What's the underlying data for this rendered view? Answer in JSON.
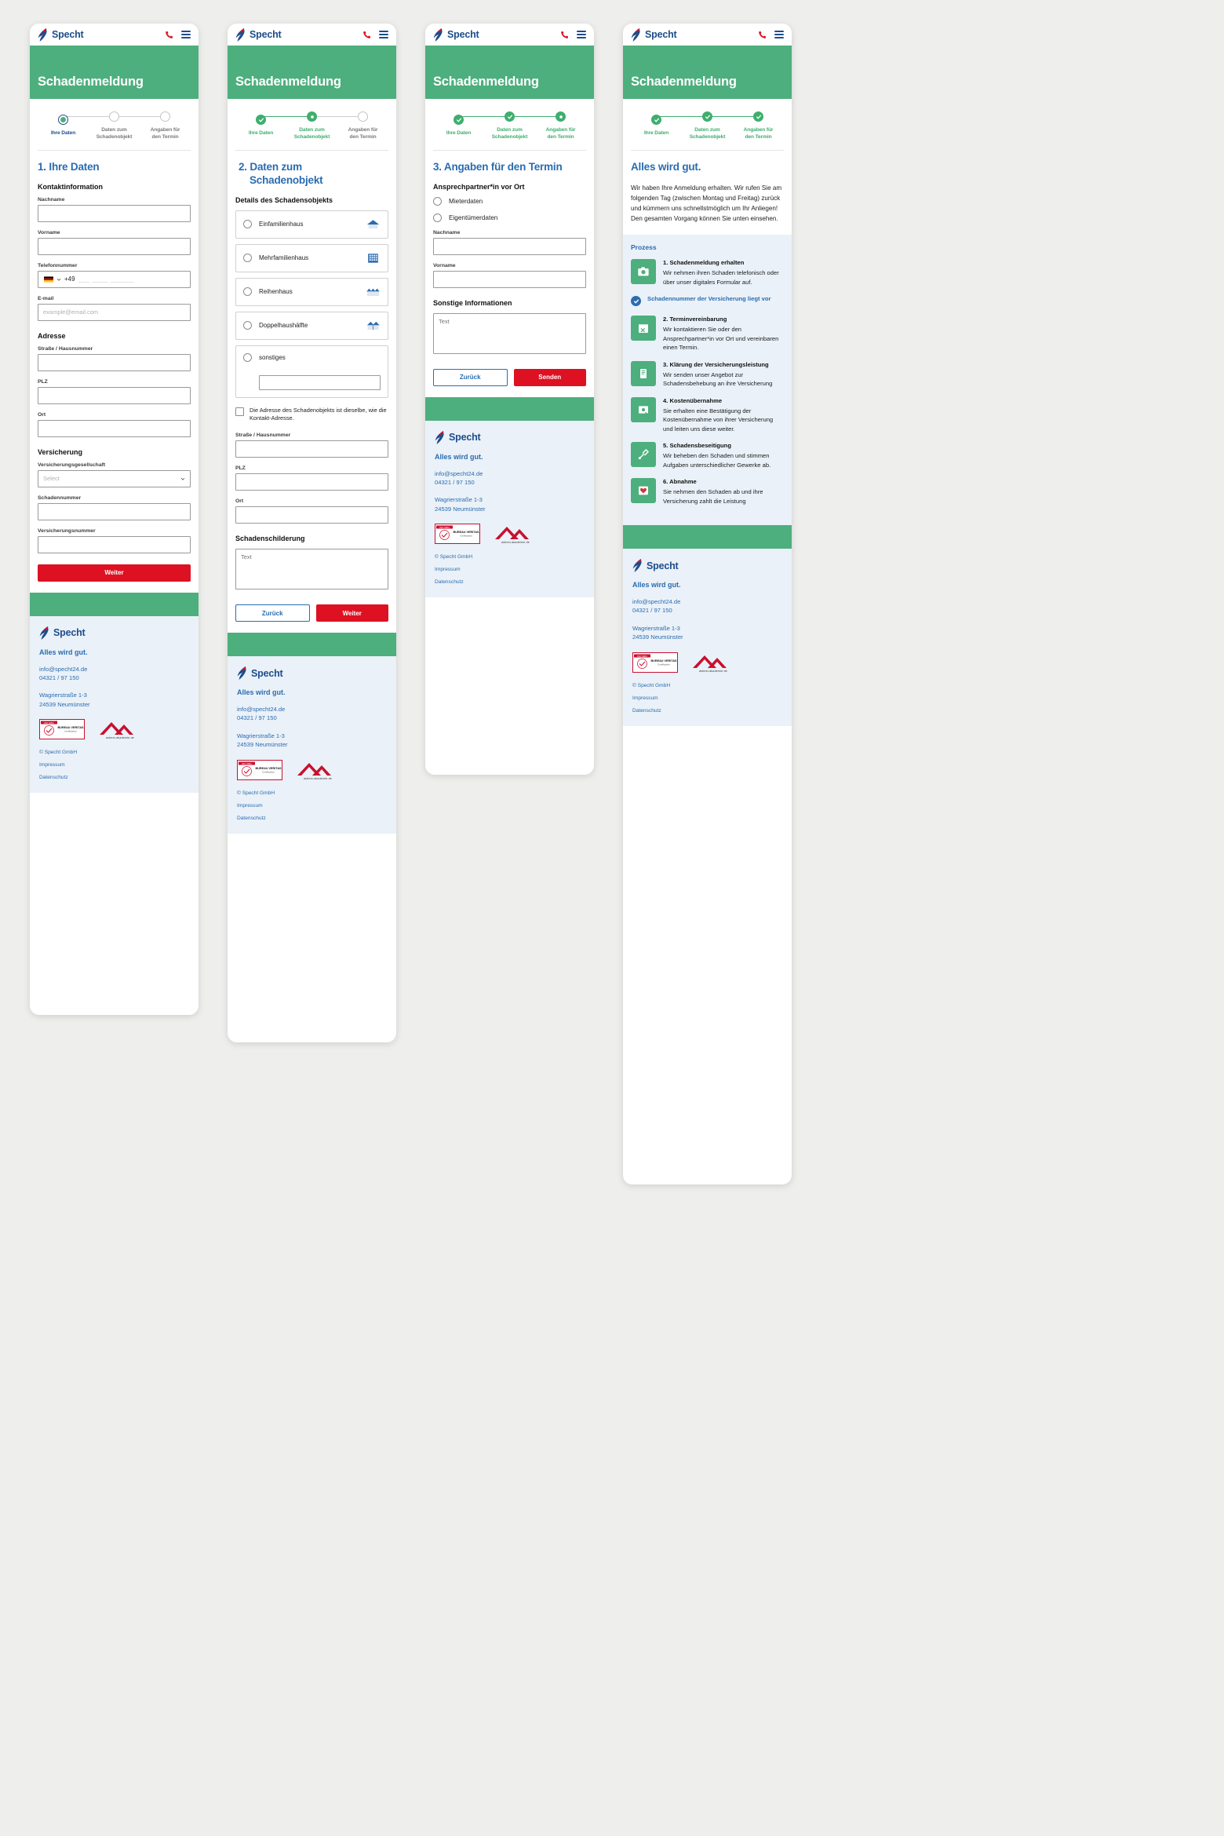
{
  "brand": {
    "name": "Specht",
    "slogan": "Alles wird gut.",
    "logo_icon": "specht-bird-logo",
    "phone_icon": "phone-icon",
    "menu_icon": "hamburger-menu-icon"
  },
  "hero": {
    "title": "Schadenmeldung"
  },
  "stepper": {
    "step1": "Ihre Daten",
    "step2_line1": "Daten zum",
    "step2_line2": "Schadenobjekt",
    "step3_line1": "Angaben für",
    "step3_line2": "den Termin"
  },
  "step1": {
    "title": "1. Ihre Daten",
    "group_contact": "Kontaktinformation",
    "nachname": "Nachname",
    "vorname": "Vorname",
    "telefonnummer": "Telefonnummer",
    "country_code": "+49",
    "phone_mask": "___  ____  ______",
    "email_label": "E-mail",
    "email_placeholder": "example@email.com",
    "group_address": "Adresse",
    "strasse": "Straße / Hausnummer",
    "plz": "PLZ",
    "ort": "Ort",
    "group_insurance": "Versicherung",
    "gesellschaft": "Versicherungsgesellschaft",
    "gesellschaft_placeholder": "Select",
    "schadennummer": "Schadennummer",
    "versicherungsnummer": "Versicherungsnummer",
    "weiter": "Weiter"
  },
  "step2": {
    "title_line1": "2. Daten zum",
    "title_line2": "Schadenobjekt",
    "group_details": "Details des Schadensobjekts",
    "options": [
      {
        "label": "Einfamilienhaus",
        "icon": "single-family-house-icon"
      },
      {
        "label": "Mehrfamilienhaus",
        "icon": "apartment-building-icon"
      },
      {
        "label": "Reihenhaus",
        "icon": "terraced-house-icon"
      },
      {
        "label": "Doppelhaushälfte",
        "icon": "semi-detached-house-icon"
      },
      {
        "label": "sonstiges",
        "icon": "none"
      }
    ],
    "sonstiges_value": "",
    "checkbox_label": "Die Adresse des Schadenobjekts ist dieselbe, wie die Kontakt-Adresse.",
    "strasse": "Straße / Hausnummer",
    "plz": "PLZ",
    "ort": "Ort",
    "schadenschilderung": "Schadenschilderung",
    "textarea_placeholder": "Text",
    "zurueck": "Zurück",
    "weiter": "Weiter"
  },
  "step3": {
    "title": "3. Angaben für den Termin",
    "group_contact_onsite": "Ansprechpartner*in vor Ort",
    "radio_mieter": "Mieterdaten",
    "radio_eigentuemer": "Eigentümerdaten",
    "nachname": "Nachname",
    "vorname": "Vorname",
    "group_other": "Sonstige Informationen",
    "textarea_placeholder": "Text",
    "zurueck": "Zurück",
    "senden": "Senden"
  },
  "step4": {
    "title": "Alles wird gut.",
    "paragraph": "Wir haben Ihre Anmeldung erhalten. Wir rufen Sie am folgenden Tag (zwischen Montag und Freitag) zurück und kümmern uns schnellstmöglich um Ihr Anliegen!\nDen gesamten Vorgang können Sie unten einsehen.",
    "process_title": "Prozess",
    "check_note": "Schadennummer der Versicherung liegt vor",
    "items": [
      {
        "num": "1.",
        "head": "Schadenmeldung erhalten",
        "desc": "Wir nehmen ihren Schaden telefonisch oder über unser digitales Formular auf.",
        "icon": "camera-icon"
      },
      {
        "num": "2.",
        "head": "Terminvereinbarung",
        "desc": "Wir kontaktieren Sie oder den Ansprechpartner*in vor Ort und vereinbaren einen Termin.",
        "icon": "calendar-icon"
      },
      {
        "num": "3.",
        "head": "Klärung der Versicherungsleistung",
        "desc": "Wir senden unser Angebot zur Schadensbehebung an ihre Versicherung",
        "icon": "document-icon"
      },
      {
        "num": "4.",
        "head": "Kostenübernahme",
        "desc": "Sie erhalten eine Bestätigung der Kostenübernahme von ihrer Versicherung und leiten uns diese weiter.",
        "icon": "money-document-icon"
      },
      {
        "num": "5.",
        "head": "Schadensbeseitigung",
        "desc": "Wir beheben den Schaden und stimmen Aufgaben unterschiedlicher Gewerke ab.",
        "icon": "tools-icon"
      },
      {
        "num": "6.",
        "head": "Abnahme",
        "desc": "Sie nehmen den Schaden ab und ihre Versicherung zahlt die Leistung",
        "icon": "heart-icon"
      }
    ]
  },
  "footer": {
    "slogan": "Alles wird gut.",
    "email": "info@specht24.de",
    "phone": "04321 / 97 150",
    "street": "Wagrierstraße 1-3",
    "city": "24539 Neumünster",
    "badge1": "bureau-veritas-certification-badge",
    "badge1_text1": "ISO 9001",
    "badge1_text2": "BUREAU VERITAS",
    "badge1_text3": "Certification",
    "badge2": "asbest-akademie-logo",
    "badge2_text": "asbest-akademie.de",
    "copyright": "© Specht GmbH",
    "impressum": "Impressum",
    "datenschutz": "Datenschutz"
  },
  "colors": {
    "green": "#4caf7d",
    "blue": "#2a6cb0",
    "red": "#dd1122",
    "footer_bg": "#eaf1f8",
    "page_bg": "#eeeeec"
  }
}
